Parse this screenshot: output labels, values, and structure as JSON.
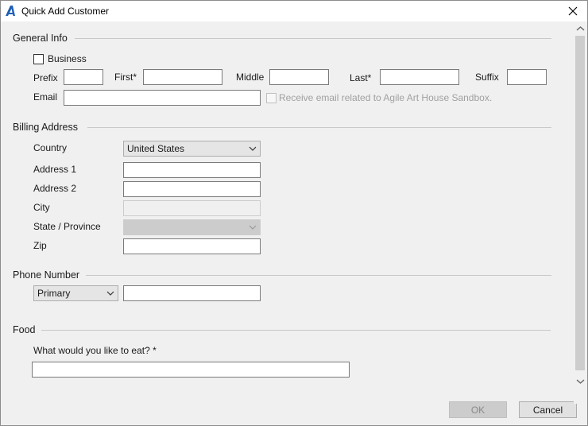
{
  "window": {
    "title": "Quick Add Customer",
    "app_icon": "agile-logo-icon",
    "close_icon": "close-icon"
  },
  "general": {
    "title": "General Info",
    "business_label": "Business",
    "prefix_label": "Prefix",
    "first_label": "First*",
    "middle_label": "Middle",
    "last_label": "Last*",
    "suffix_label": "Suffix",
    "email_label": "Email",
    "email_opt_in_label": "Receive email related to Agile Art House Sandbox.",
    "values": {
      "prefix": "",
      "first": "",
      "middle": "",
      "last": "",
      "suffix": "",
      "email": ""
    }
  },
  "billing": {
    "title": "Billing Address",
    "country_label": "Country",
    "country_value": "United States",
    "address1_label": "Address 1",
    "address2_label": "Address 2",
    "city_label": "City",
    "state_label": "State / Province",
    "state_value": "",
    "zip_label": "Zip",
    "values": {
      "address1": "",
      "address2": "",
      "city": "",
      "zip": ""
    }
  },
  "phone": {
    "title": "Phone Number",
    "type_value": "Primary",
    "number": ""
  },
  "food": {
    "title": "Food",
    "question": "What would you like to eat? *",
    "answer": ""
  },
  "buttons": {
    "ok": "OK",
    "cancel": "Cancel"
  },
  "colors": {
    "accent": "#1f5fb5",
    "window_bg": "#f0f0f0",
    "disabled_bg": "#cccccc"
  }
}
